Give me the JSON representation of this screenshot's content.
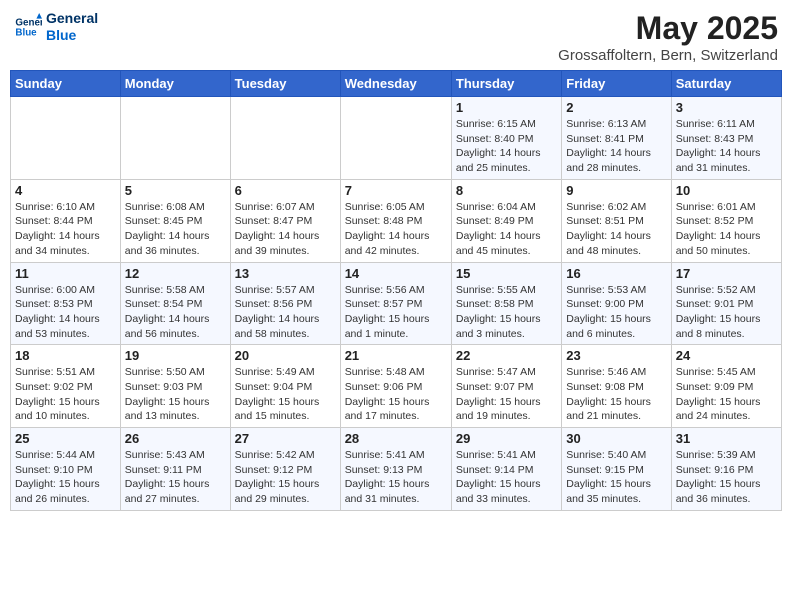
{
  "header": {
    "logo_line1": "General",
    "logo_line2": "Blue",
    "title": "May 2025",
    "subtitle": "Grossaffoltern, Bern, Switzerland"
  },
  "days_of_week": [
    "Sunday",
    "Monday",
    "Tuesday",
    "Wednesday",
    "Thursday",
    "Friday",
    "Saturday"
  ],
  "weeks": [
    [
      {
        "day": "",
        "empty": true
      },
      {
        "day": "",
        "empty": true
      },
      {
        "day": "",
        "empty": true
      },
      {
        "day": "",
        "empty": true
      },
      {
        "day": "1",
        "sunrise": "6:15 AM",
        "sunset": "8:40 PM",
        "daylight": "14 hours and 25 minutes."
      },
      {
        "day": "2",
        "sunrise": "6:13 AM",
        "sunset": "8:41 PM",
        "daylight": "14 hours and 28 minutes."
      },
      {
        "day": "3",
        "sunrise": "6:11 AM",
        "sunset": "8:43 PM",
        "daylight": "14 hours and 31 minutes."
      }
    ],
    [
      {
        "day": "4",
        "sunrise": "6:10 AM",
        "sunset": "8:44 PM",
        "daylight": "14 hours and 34 minutes."
      },
      {
        "day": "5",
        "sunrise": "6:08 AM",
        "sunset": "8:45 PM",
        "daylight": "14 hours and 36 minutes."
      },
      {
        "day": "6",
        "sunrise": "6:07 AM",
        "sunset": "8:47 PM",
        "daylight": "14 hours and 39 minutes."
      },
      {
        "day": "7",
        "sunrise": "6:05 AM",
        "sunset": "8:48 PM",
        "daylight": "14 hours and 42 minutes."
      },
      {
        "day": "8",
        "sunrise": "6:04 AM",
        "sunset": "8:49 PM",
        "daylight": "14 hours and 45 minutes."
      },
      {
        "day": "9",
        "sunrise": "6:02 AM",
        "sunset": "8:51 PM",
        "daylight": "14 hours and 48 minutes."
      },
      {
        "day": "10",
        "sunrise": "6:01 AM",
        "sunset": "8:52 PM",
        "daylight": "14 hours and 50 minutes."
      }
    ],
    [
      {
        "day": "11",
        "sunrise": "6:00 AM",
        "sunset": "8:53 PM",
        "daylight": "14 hours and 53 minutes."
      },
      {
        "day": "12",
        "sunrise": "5:58 AM",
        "sunset": "8:54 PM",
        "daylight": "14 hours and 56 minutes."
      },
      {
        "day": "13",
        "sunrise": "5:57 AM",
        "sunset": "8:56 PM",
        "daylight": "14 hours and 58 minutes."
      },
      {
        "day": "14",
        "sunrise": "5:56 AM",
        "sunset": "8:57 PM",
        "daylight": "15 hours and 1 minute."
      },
      {
        "day": "15",
        "sunrise": "5:55 AM",
        "sunset": "8:58 PM",
        "daylight": "15 hours and 3 minutes."
      },
      {
        "day": "16",
        "sunrise": "5:53 AM",
        "sunset": "9:00 PM",
        "daylight": "15 hours and 6 minutes."
      },
      {
        "day": "17",
        "sunrise": "5:52 AM",
        "sunset": "9:01 PM",
        "daylight": "15 hours and 8 minutes."
      }
    ],
    [
      {
        "day": "18",
        "sunrise": "5:51 AM",
        "sunset": "9:02 PM",
        "daylight": "15 hours and 10 minutes."
      },
      {
        "day": "19",
        "sunrise": "5:50 AM",
        "sunset": "9:03 PM",
        "daylight": "15 hours and 13 minutes."
      },
      {
        "day": "20",
        "sunrise": "5:49 AM",
        "sunset": "9:04 PM",
        "daylight": "15 hours and 15 minutes."
      },
      {
        "day": "21",
        "sunrise": "5:48 AM",
        "sunset": "9:06 PM",
        "daylight": "15 hours and 17 minutes."
      },
      {
        "day": "22",
        "sunrise": "5:47 AM",
        "sunset": "9:07 PM",
        "daylight": "15 hours and 19 minutes."
      },
      {
        "day": "23",
        "sunrise": "5:46 AM",
        "sunset": "9:08 PM",
        "daylight": "15 hours and 21 minutes."
      },
      {
        "day": "24",
        "sunrise": "5:45 AM",
        "sunset": "9:09 PM",
        "daylight": "15 hours and 24 minutes."
      }
    ],
    [
      {
        "day": "25",
        "sunrise": "5:44 AM",
        "sunset": "9:10 PM",
        "daylight": "15 hours and 26 minutes."
      },
      {
        "day": "26",
        "sunrise": "5:43 AM",
        "sunset": "9:11 PM",
        "daylight": "15 hours and 27 minutes."
      },
      {
        "day": "27",
        "sunrise": "5:42 AM",
        "sunset": "9:12 PM",
        "daylight": "15 hours and 29 minutes."
      },
      {
        "day": "28",
        "sunrise": "5:41 AM",
        "sunset": "9:13 PM",
        "daylight": "15 hours and 31 minutes."
      },
      {
        "day": "29",
        "sunrise": "5:41 AM",
        "sunset": "9:14 PM",
        "daylight": "15 hours and 33 minutes."
      },
      {
        "day": "30",
        "sunrise": "5:40 AM",
        "sunset": "9:15 PM",
        "daylight": "15 hours and 35 minutes."
      },
      {
        "day": "31",
        "sunrise": "5:39 AM",
        "sunset": "9:16 PM",
        "daylight": "15 hours and 36 minutes."
      }
    ]
  ],
  "labels": {
    "sunrise_prefix": "Sunrise: ",
    "sunset_prefix": "Sunset: ",
    "daylight_label": "Daylight: "
  }
}
